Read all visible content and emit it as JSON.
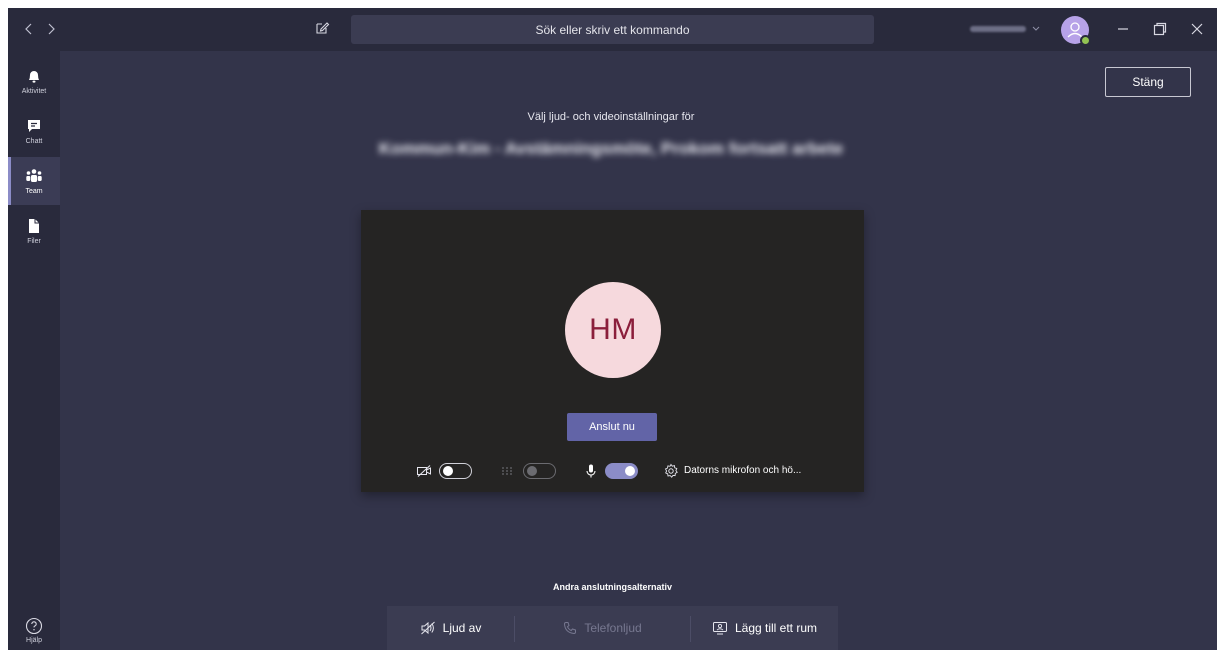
{
  "titlebar": {
    "back_icon": "chevron-left-icon",
    "forward_icon": "chevron-right-icon",
    "compose_icon": "new-chat-icon",
    "search_placeholder": "Sök eller skriv ett kommando",
    "presence_color": "#92c353"
  },
  "rail": {
    "items": [
      {
        "label": "Aktivitet",
        "icon": "bell-icon"
      },
      {
        "label": "Chatt",
        "icon": "chat-icon"
      },
      {
        "label": "Team",
        "icon": "teams-icon",
        "active": true
      },
      {
        "label": "Filer",
        "icon": "file-icon"
      }
    ],
    "help_label": "Hjälp"
  },
  "main": {
    "close_label": "Stäng",
    "subtitle": "Välj ljud- och videoinställningar för",
    "meeting_title_blurred": "Kommun-Kim - Avstämningsmöte, Prokom fortsatt arbete",
    "avatar_initials": "HM",
    "join_label": "Anslut nu",
    "controls": {
      "camera_on": false,
      "blur_enabled": false,
      "mic_on": true,
      "device_label": "Datorns mikrofon och hö..."
    },
    "other_options_title": "Andra anslutningsalternativ",
    "options": [
      {
        "label": "Ljud av",
        "icon": "speaker-off-icon",
        "enabled": true
      },
      {
        "label": "Telefonljud",
        "icon": "phone-icon",
        "enabled": false
      },
      {
        "label": "Lägg till ett rum",
        "icon": "room-icon",
        "enabled": true
      }
    ]
  },
  "colors": {
    "background": "#33344a",
    "chrome": "#292a3c",
    "accent": "#6264a7",
    "toggle_on": "#8b8cc7",
    "avatar_bg": "#f6d9dd",
    "avatar_text": "#8b1e3b"
  }
}
